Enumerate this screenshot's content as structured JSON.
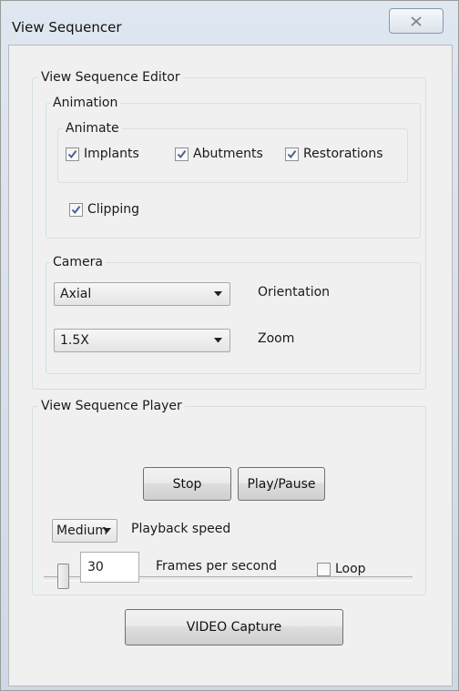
{
  "window": {
    "title": "View Sequencer"
  },
  "editor": {
    "label": "View Sequence Editor",
    "animation": {
      "label": "Animation",
      "animate": {
        "label": "Animate",
        "items": [
          {
            "label": "Implants",
            "checked": true
          },
          {
            "label": "Abutments",
            "checked": true
          },
          {
            "label": "Restorations",
            "checked": true
          }
        ]
      },
      "clipping": {
        "label": "Clipping",
        "checked": true
      }
    },
    "camera": {
      "label": "Camera",
      "orientation": {
        "value": "Axial",
        "label": "Orientation"
      },
      "zoom": {
        "value": "1.5X",
        "label": "Zoom"
      }
    }
  },
  "player": {
    "label": "View Sequence Player",
    "slider_value": 0,
    "stop_label": "Stop",
    "play_pause_label": "Play/Pause",
    "speed": {
      "value": "Medium",
      "label": "Playback speed"
    },
    "fps": {
      "value": "30",
      "label": "Frames per second"
    },
    "loop": {
      "label": "Loop",
      "checked": false
    }
  },
  "capture_label": "VIDEO Capture",
  "icons": {
    "close": "close-icon",
    "check": "checkmark-icon",
    "dropdown": "dropdown-arrow-icon"
  }
}
